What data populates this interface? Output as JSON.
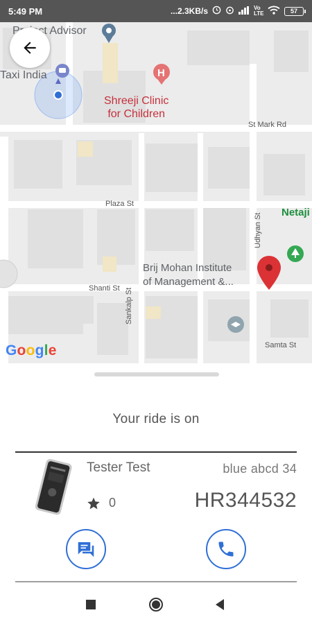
{
  "status_bar": {
    "time": "5:49 PM",
    "network_speed": "...2.3KB/s",
    "network_type": "Vo LTE",
    "battery": "57",
    "icons": [
      "timer-icon",
      "alarm-icon",
      "signal-icon",
      "wifi-icon",
      "battery-icon"
    ]
  },
  "map": {
    "poi_advisor": "Project Advisor",
    "poi_taxi": "Taxi India",
    "clinic_line1": "Shreeji Clinic",
    "clinic_line2": "for Children",
    "street_st_mark": "St Mark Rd",
    "street_plaza": "Plaza St",
    "street_shanti": "Shanti St",
    "street_sankalp": "Sankalp St",
    "street_udhyan": "Udhyan St",
    "street_samta": "Samta St",
    "place_netaji": "Netaji",
    "institute_line1": "Brij Mohan Institute",
    "institute_line2": "of Management &...",
    "attribution": "Google",
    "colors": {
      "pin_red": "#db3236",
      "location_blue": "#4285F4",
      "clinic_red": "#c5303a",
      "park_green": "#1e8e3e"
    }
  },
  "ride": {
    "status": "Your ride is on",
    "driver_name": "Tester Test",
    "rating": "0",
    "vehicle_desc": "blue abcd 34",
    "plate_number": "HR344532",
    "accent_color": "#2f6fd6"
  },
  "nav": {
    "icons": [
      "recents-square-icon",
      "home-circle-icon",
      "back-triangle-icon"
    ]
  }
}
